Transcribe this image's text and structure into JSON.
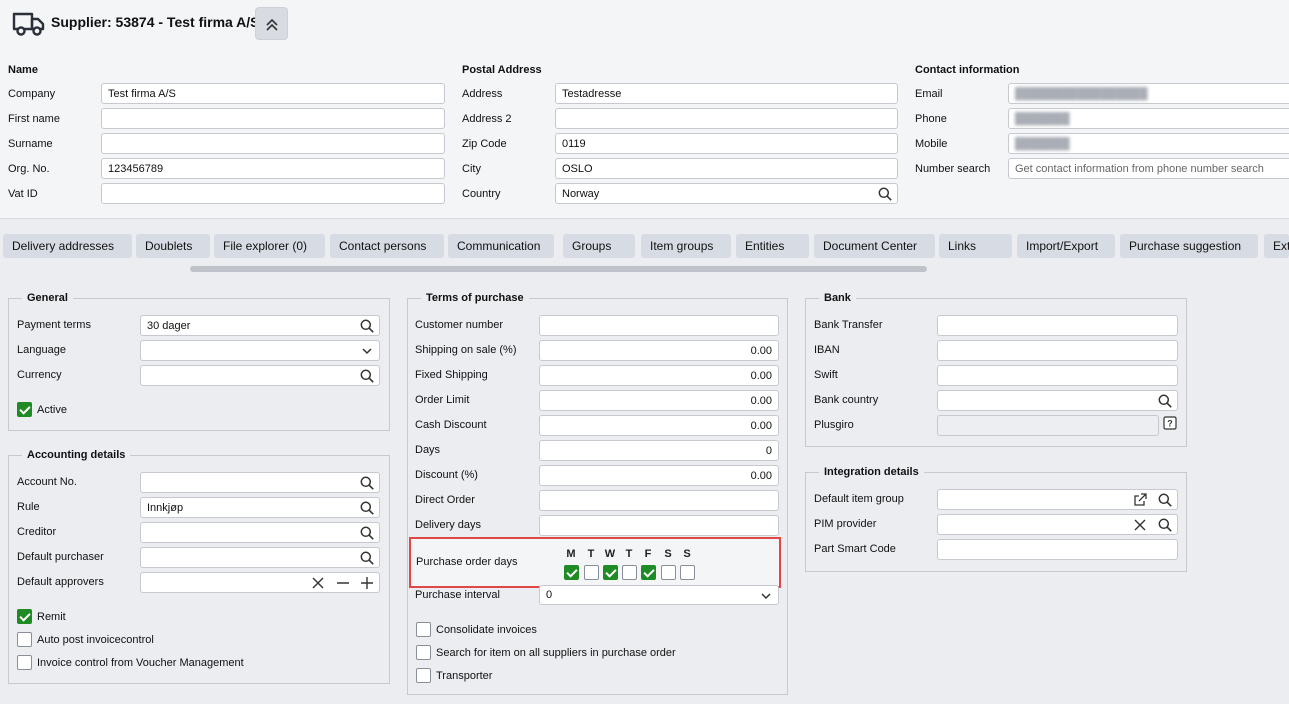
{
  "header": {
    "title": "Supplier: 53874 - Test firma A/S"
  },
  "name_section": {
    "heading": "Name",
    "fields": [
      {
        "label": "Company",
        "value": "Test firma A/S"
      },
      {
        "label": "First name",
        "value": ""
      },
      {
        "label": "Surname",
        "value": ""
      },
      {
        "label": "Org. No.",
        "value": "123456789"
      },
      {
        "label": "Vat ID",
        "value": ""
      }
    ]
  },
  "postal_section": {
    "heading": "Postal Address",
    "fields": [
      {
        "label": "Address",
        "value": "Testadresse"
      },
      {
        "label": "Address 2",
        "value": ""
      },
      {
        "label": "Zip Code",
        "value": "0119"
      },
      {
        "label": "City",
        "value": "OSLO"
      },
      {
        "label": "Country",
        "value": "Norway"
      }
    ]
  },
  "contact_section": {
    "heading": "Contact information",
    "fields": [
      {
        "label": "Email"
      },
      {
        "label": "Phone"
      },
      {
        "label": "Mobile"
      },
      {
        "label": "Number search",
        "placeholder": "Get contact information from phone number search"
      }
    ]
  },
  "tabs": [
    "Delivery addresses",
    "Doublets",
    "File explorer (0)",
    "Contact persons",
    "Communication",
    "Groups",
    "Item groups",
    "Entities",
    "Document Center",
    "Links",
    "Import/Export",
    "Purchase suggestion",
    "Ext"
  ],
  "general": {
    "heading": "General",
    "payment_terms_label": "Payment terms",
    "payment_terms_value": "30 dager",
    "language_label": "Language",
    "currency_label": "Currency",
    "active_label": "Active"
  },
  "accounting": {
    "heading": "Accounting details",
    "account_label": "Account No.",
    "rule_label": "Rule",
    "rule_value": "Innkjøp",
    "creditor_label": "Creditor",
    "purchaser_label": "Default purchaser",
    "approvers_label": "Default approvers",
    "remit_label": "Remit",
    "autopost_label": "Auto post invoicecontrol",
    "voucher_label": "Invoice control from Voucher Management"
  },
  "terms": {
    "heading": "Terms of purchase",
    "fields": [
      {
        "label": "Customer number",
        "value": ""
      },
      {
        "label": "Shipping on sale (%)",
        "value": "0.00"
      },
      {
        "label": "Fixed Shipping",
        "value": "0.00"
      },
      {
        "label": "Order Limit",
        "value": "0.00"
      },
      {
        "label": "Cash Discount",
        "value": "0.00"
      },
      {
        "label": "Days",
        "value": "0"
      },
      {
        "label": "Discount (%)",
        "value": "0.00"
      },
      {
        "label": "Direct Order",
        "value": ""
      },
      {
        "label": "Delivery days",
        "value": ""
      }
    ],
    "order_days_label": "Purchase order days",
    "days": [
      {
        "letter": "M",
        "checked": true
      },
      {
        "letter": "T",
        "checked": false
      },
      {
        "letter": "W",
        "checked": true
      },
      {
        "letter": "T",
        "checked": false
      },
      {
        "letter": "F",
        "checked": true
      },
      {
        "letter": "S",
        "checked": false
      },
      {
        "letter": "S",
        "checked": false
      }
    ],
    "interval_label": "Purchase interval",
    "interval_value": "0",
    "consolidate_label": "Consolidate invoices",
    "search_all_label": "Search for item on all suppliers in purchase order",
    "transporter_label": "Transporter"
  },
  "bank": {
    "heading": "Bank",
    "transfer_label": "Bank Transfer",
    "iban_label": "IBAN",
    "swift_label": "Swift",
    "country_label": "Bank country",
    "plusgiro_label": "Plusgiro"
  },
  "integration": {
    "heading": "Integration details",
    "item_group_label": "Default item group",
    "pim_label": "PIM provider",
    "smart_code_label": "Part Smart Code"
  },
  "colors": {
    "accent_check": "#1f8b24",
    "highlight": "#e04848",
    "tab_bg": "#d7dbe3"
  }
}
